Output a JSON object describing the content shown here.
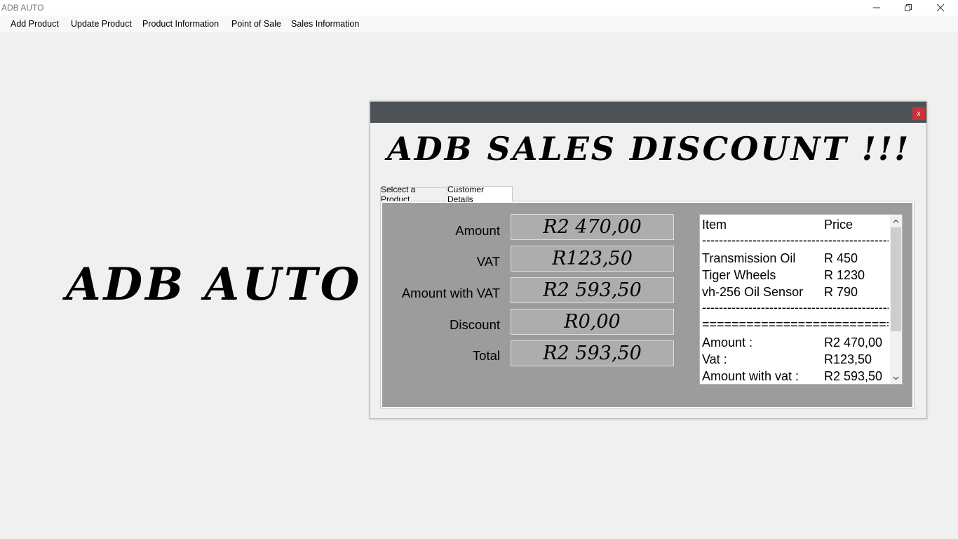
{
  "window": {
    "title": "ADB AUTO"
  },
  "menu": [
    {
      "label": "Add Product"
    },
    {
      "label": "Update Product"
    },
    {
      "label": "Product Information"
    },
    {
      "label": "Point of Sale"
    },
    {
      "label": "Sales Information"
    }
  ],
  "logo": "ADB AUTO",
  "dialog": {
    "close_label": "x",
    "banner": "ADB SALES  DISCOUNT !!!",
    "tabs": [
      {
        "label": "Selcect a Product"
      },
      {
        "label": "Customer Details"
      }
    ],
    "fields": [
      {
        "label": "Amount",
        "value": "R2 470,00"
      },
      {
        "label": "VAT",
        "value": "R123,50"
      },
      {
        "label": "Amount with VAT",
        "value": "R2 593,50"
      },
      {
        "label": "Discount",
        "value": "R0,00"
      },
      {
        "label": "Total",
        "value": "R2 593,50"
      }
    ],
    "receipt": {
      "header_item": "Item",
      "header_price": "Price",
      "dash_line": "------------------------------------------------------------",
      "double_line": "============================================",
      "items": [
        {
          "name": "Transmission Oil",
          "price": "R 450"
        },
        {
          "name": "Tiger Wheels",
          "price": "R 1230"
        },
        {
          "name": "vh-256 Oil Sensor",
          "price": "R 790"
        }
      ],
      "totals": [
        {
          "label": "Amount :",
          "value": "R2 470,00"
        },
        {
          "label": "Vat :",
          "value": "R123,50"
        },
        {
          "label": "Amount with vat :",
          "value": "R2 593,50"
        }
      ]
    }
  },
  "icons": {
    "minimize": "minimize-icon",
    "maximize": "restore-icon",
    "close": "close-icon",
    "scroll_up": "chevron-up-icon",
    "scroll_down": "chevron-down-icon"
  }
}
